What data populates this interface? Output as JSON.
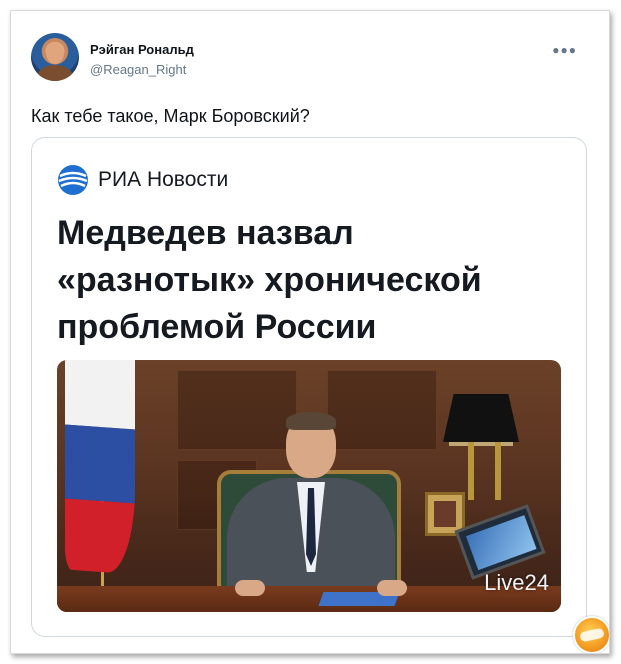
{
  "tweet": {
    "display_name": "Рэйган Рональд",
    "handle": "@Reagan_Right",
    "more_icon": "more-horizontal-icon",
    "text": "Как тебе такое, Марк Боровский?"
  },
  "card": {
    "brand": "РИА Новости",
    "headline_lines": [
      "Медведев назвал",
      "«разнотык» хронической",
      "проблемой России"
    ],
    "photo_watermark": "Live24"
  },
  "colors": {
    "handle": "#657786",
    "card_border": "#cfd9de",
    "ria_blue": "#1f6fd1"
  }
}
